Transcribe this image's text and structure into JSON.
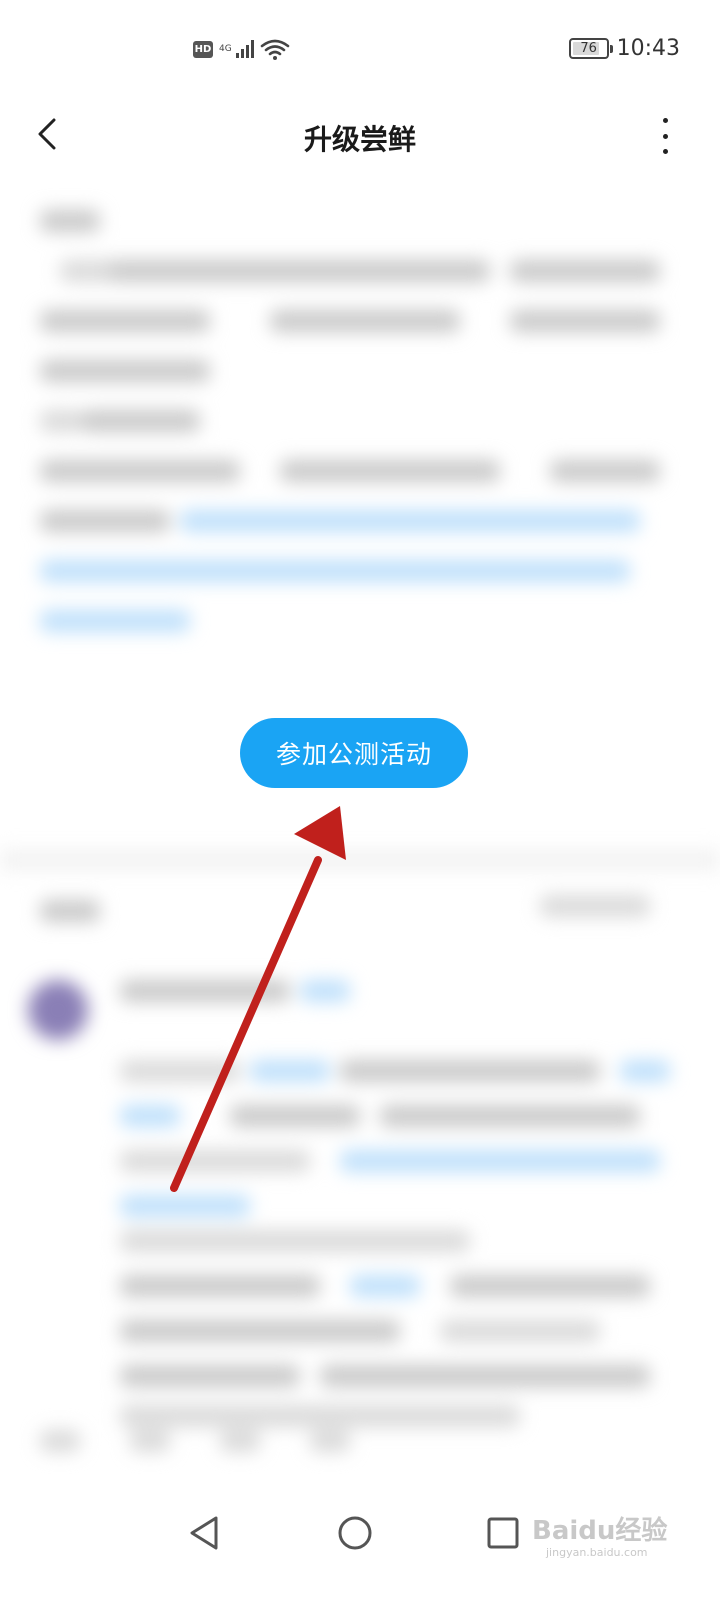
{
  "status_bar": {
    "hd_label": "HD",
    "network_label": "4G",
    "battery_level": "76",
    "time": "10:43"
  },
  "app_bar": {
    "title": "升级尝鲜"
  },
  "main": {
    "join_button_label": "参加公测活动"
  },
  "watermark": {
    "brand": "Baidu经验",
    "url": "jingyan.baidu.com"
  },
  "colors": {
    "accent": "#1aa4f4",
    "arrow": "#c0201c"
  }
}
